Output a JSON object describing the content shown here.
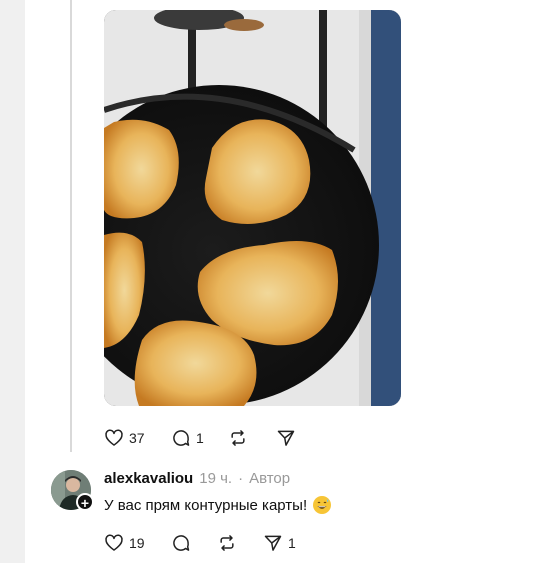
{
  "post": {
    "image_alt": "pancakes-in-frying-pan",
    "likes": "37",
    "replies": "1"
  },
  "reply": {
    "username": "alexkavaliou",
    "time": "19 ч.",
    "separator": "·",
    "author_badge": "Автор",
    "text": "У вас прям контурные карты!",
    "emoji": "grinning-sweat-emoji",
    "likes": "19",
    "shares": "1"
  },
  "colors": {
    "background": "#f0f0f0",
    "card": "#ffffff",
    "muted": "#999999",
    "thread_line": "#d9d9d9"
  }
}
